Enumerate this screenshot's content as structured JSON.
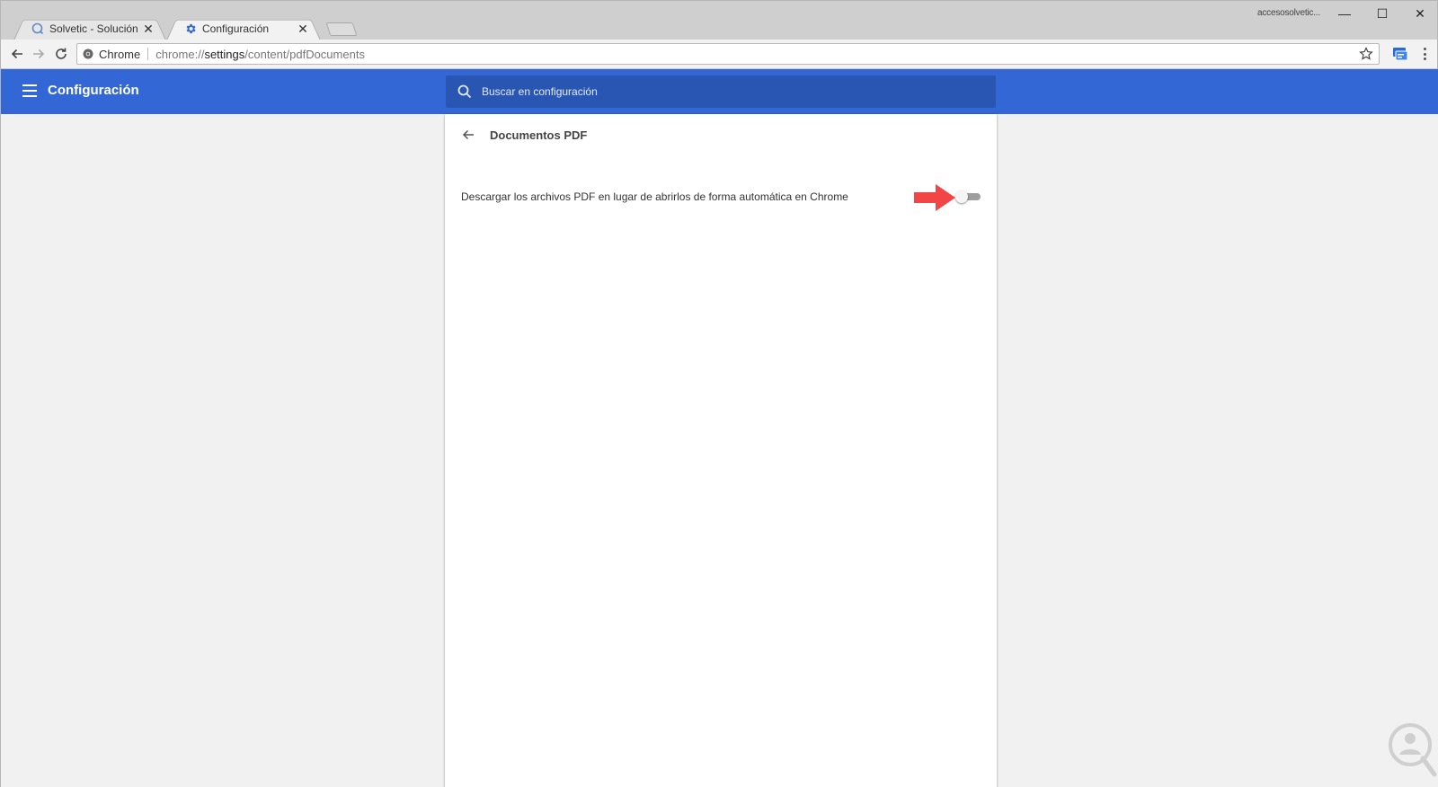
{
  "browser": {
    "tabs": [
      {
        "title": "Solvetic - Solución a los p",
        "close": "✕",
        "active": false,
        "favicon": "solvetic-favicon-icon"
      },
      {
        "title": "Configuración",
        "close": "✕",
        "active": true,
        "favicon": "gear-icon"
      }
    ],
    "user_name": "accesosolvetic...",
    "window_controls": {
      "minimize": "—",
      "maximize": "☐",
      "close": "✕"
    }
  },
  "omnibox": {
    "secure_label": "Chrome",
    "url_scheme": "chrome://",
    "url_host": "settings",
    "url_path": "/content/pdfDocuments"
  },
  "header": {
    "title": "Configuración",
    "search_placeholder": "Buscar en configuración"
  },
  "subpage": {
    "title": "Documentos PDF",
    "setting_label": "Descargar los archivos PDF en lugar de abrirlos de forma automática en Chrome",
    "toggle_on": false
  },
  "colors": {
    "header_blue": "#3367d6",
    "search_blue": "#2a56b3",
    "arrow_red": "#f24545"
  }
}
